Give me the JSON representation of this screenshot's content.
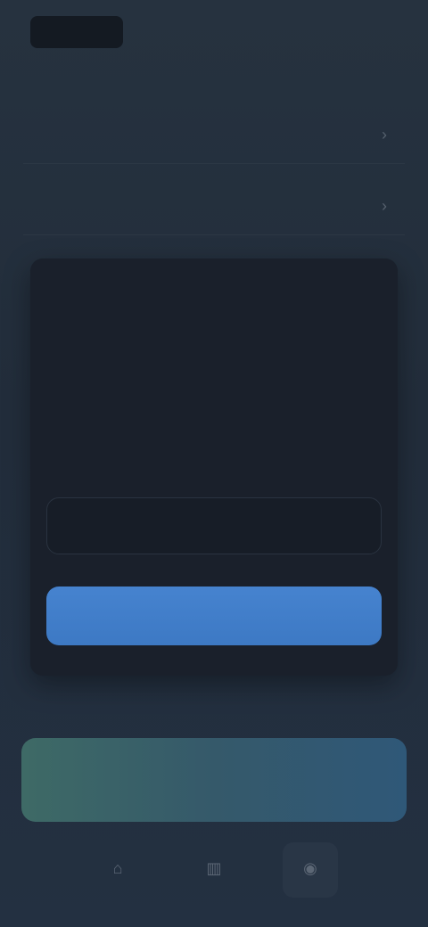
{
  "header": {
    "logo_text": "",
    "action_label": ""
  },
  "settings": {
    "rows": [
      {
        "label": ""
      },
      {
        "label": ""
      }
    ]
  },
  "modal": {
    "title": "",
    "message": "",
    "secondary_label": "",
    "primary_label": ""
  },
  "section": {
    "label": ""
  },
  "banner": {
    "text": ""
  },
  "nav": {
    "items": [
      {
        "icon": "home-icon",
        "label": ""
      },
      {
        "icon": "chart-icon",
        "label": ""
      },
      {
        "icon": "profile-icon",
        "label": ""
      }
    ]
  },
  "colors": {
    "background": "#232f3f",
    "modal": "#1a202b",
    "primary": "#4683cf",
    "banner_start": "#3e6a66",
    "banner_end": "#2f5878"
  }
}
